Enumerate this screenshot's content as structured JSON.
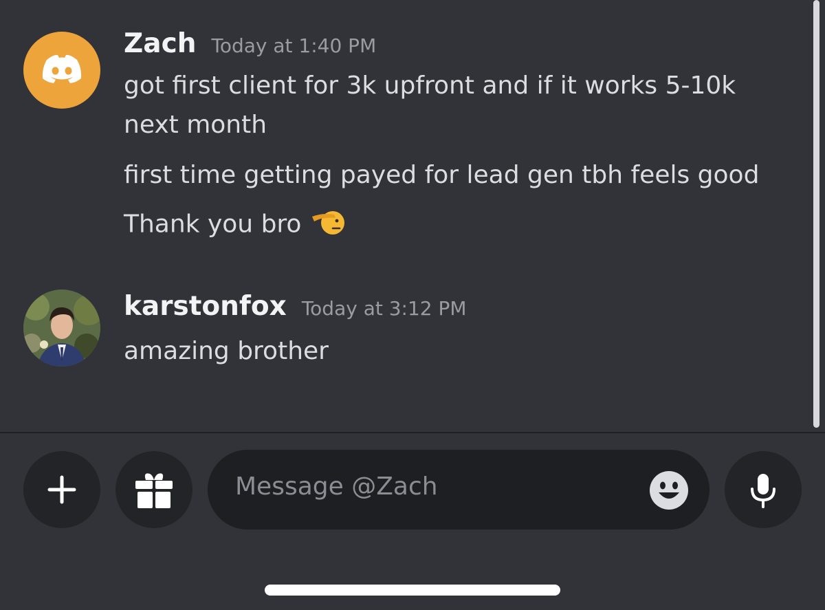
{
  "messages": [
    {
      "username": "Zach",
      "timestamp": "Today at 1:40 PM",
      "avatar": "discord-logo-avatar",
      "avatar_color": "#eca43b",
      "lines": [
        "got first client for 3k upfront and if it works 5-10k",
        "next month",
        "first time getting payed for lead gen tbh feels good",
        "Thank you bro"
      ],
      "emoji": "saluting-face"
    },
    {
      "username": "karstonfox",
      "timestamp": "Today at 3:12 PM",
      "avatar": "user-photo-avatar",
      "lines": [
        "amazing brother"
      ]
    }
  ],
  "composer": {
    "placeholder": "Message @Zach",
    "buttons": [
      "plus-icon",
      "gift-icon",
      "emoji-icon",
      "microphone-icon"
    ]
  },
  "colors": {
    "background": "#313338",
    "input_background": "#1e1f22",
    "button_background": "#232428",
    "text": "#dbdee1",
    "timestamp": "#9a9ca3"
  }
}
